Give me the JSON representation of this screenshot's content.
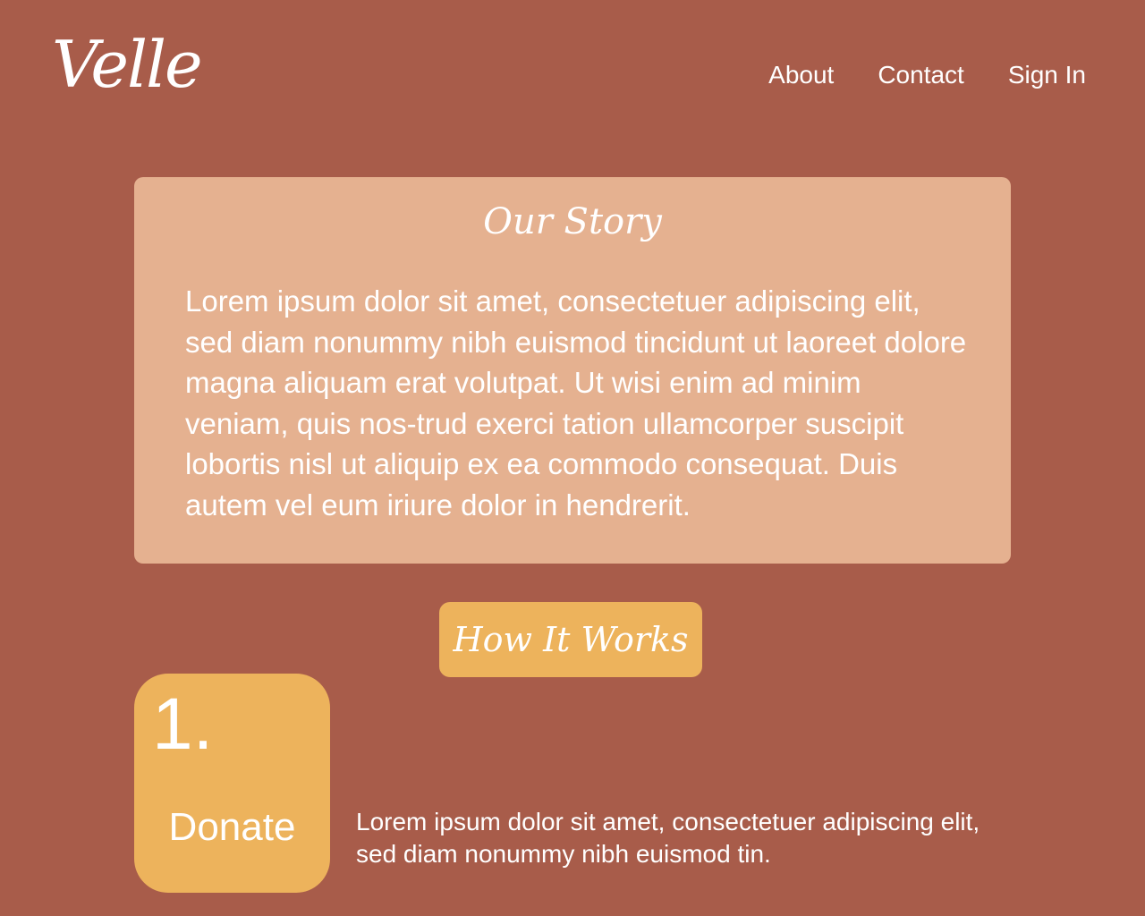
{
  "header": {
    "logo": "Velle",
    "nav": [
      {
        "label": "About"
      },
      {
        "label": "Contact"
      },
      {
        "label": "Sign In"
      }
    ]
  },
  "story": {
    "title": "Our Story",
    "body": "Lorem ipsum dolor sit amet, consectetuer adipiscing elit, sed diam nonummy nibh euismod tincidunt ut laoreet dolore magna aliquam erat volutpat. Ut wisi enim ad minim veniam, quis nos-trud exerci tation ullamcorper suscipit lobortis nisl ut aliquip ex ea commodo consequat. Duis autem vel eum iriure dolor in hendrerit."
  },
  "how_it_works": {
    "button_label": "How It Works",
    "steps": [
      {
        "number": "1.",
        "label": "Donate",
        "description": "Lorem ipsum dolor sit amet, consectetuer adipiscing elit, sed diam nonummy nibh euismod tin."
      }
    ]
  },
  "colors": {
    "background": "#a85c4a",
    "story_card": "#e5b190",
    "accent": "#edb35c",
    "text": "#ffffff"
  }
}
